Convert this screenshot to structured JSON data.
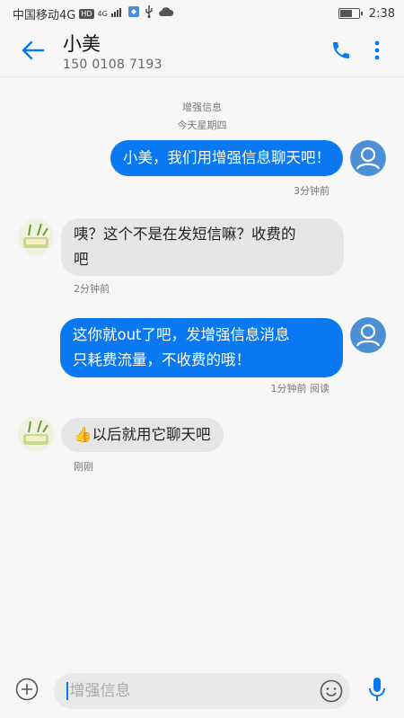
{
  "status_bar": {
    "carrier": "中国移动4G",
    "hd": "HD",
    "signal_label": "4G",
    "time": "2:38"
  },
  "header": {
    "contact_name": "小美",
    "contact_number": "150 0108 7193"
  },
  "conversation": {
    "service_label": "增强信息",
    "date_label": "今天星期四",
    "messages": [
      {
        "direction": "outgoing",
        "text": "小美，我们用增强信息聊天吧！",
        "meta": "3分钟前"
      },
      {
        "direction": "incoming",
        "line1": "咦？这个不是在发短信嘛？收费的",
        "line2": "吧",
        "meta": "2分钟前"
      },
      {
        "direction": "outgoing",
        "line1": "这你就out了吧，发增强信息消息",
        "line2": "只耗费流量，不收费的哦！",
        "meta": "1分钟前 阅读"
      },
      {
        "direction": "incoming",
        "emoji": "👍",
        "text": "以后就用它聊天吧",
        "meta": "刚刚"
      }
    ]
  },
  "input_bar": {
    "placeholder": "增强信息"
  },
  "colors": {
    "accent": "#0a79f1",
    "incoming_bubble": "#e6e6e6",
    "outgoing_bubble": "#0a79f1"
  },
  "icons": {
    "back": "back-arrow-icon",
    "call": "phone-icon",
    "more": "more-vertical-icon",
    "add": "add-circle-icon",
    "emoji": "smiley-icon",
    "voice": "microphone-icon"
  }
}
